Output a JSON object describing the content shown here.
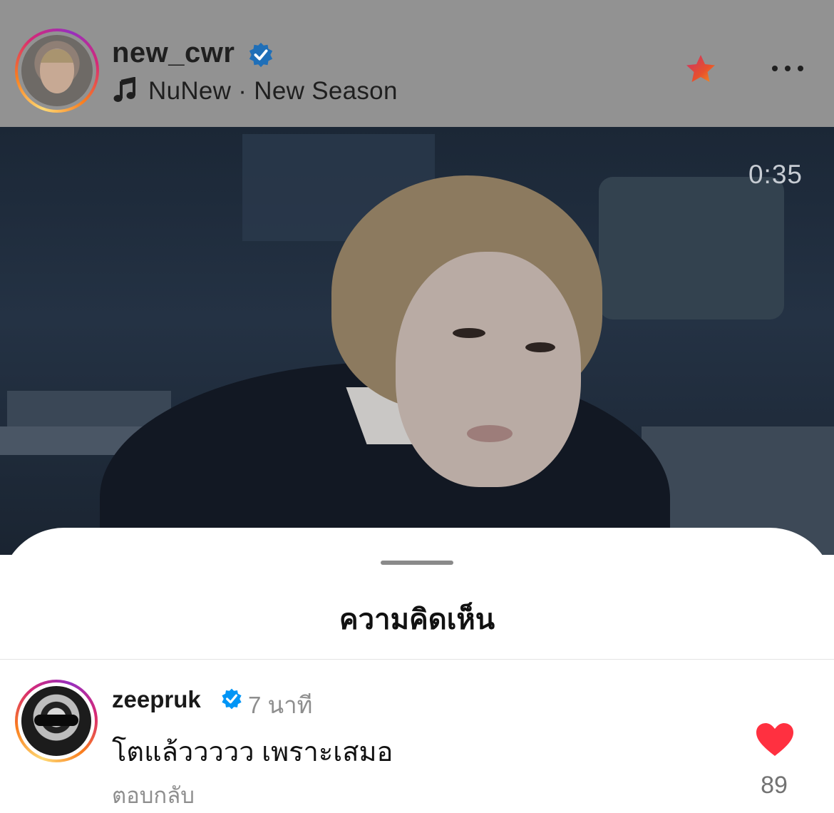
{
  "post": {
    "username": "new_cwr",
    "music_icon": "music-note-icon",
    "song": "NuNew · New Season",
    "favorite_icon": "star-icon",
    "more_icon": "more-options-icon"
  },
  "video": {
    "timestamp": "0:35"
  },
  "comments_sheet": {
    "title": "ความคิดเห็น",
    "comments": [
      {
        "username": "zeepruk",
        "time": "7 นาที",
        "text": "โตแล้ววววว เพราะเสมอ",
        "reply_label": "ตอบกลับ",
        "likes": "89",
        "liked": true
      }
    ]
  },
  "colors": {
    "verified": "#0095f6",
    "heart": "#ff3040",
    "star": "#f0552a"
  }
}
